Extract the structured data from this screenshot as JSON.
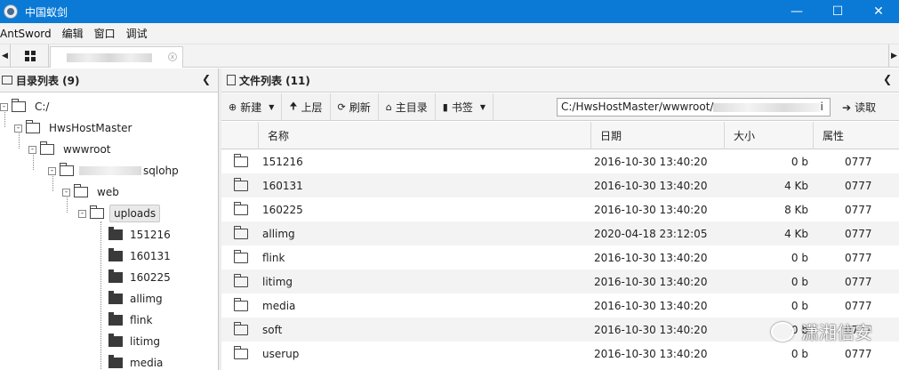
{
  "window": {
    "title": "中国蚁剑"
  },
  "menubar": {
    "items": [
      "AntSword",
      "编辑",
      "窗口",
      "调试"
    ]
  },
  "left_panel": {
    "header": "目录列表 (9)",
    "tree": {
      "root": "C:/",
      "hws": "HwsHostMaster",
      "wwwroot": "wwwroot",
      "site_suffix": "sqlohp",
      "web": "web",
      "uploads": "uploads",
      "children": [
        "151216",
        "160131",
        "160225",
        "allimg",
        "flink",
        "litimg",
        "media"
      ]
    }
  },
  "right_panel": {
    "header": "文件列表 (11)",
    "toolbar": {
      "new": "新建",
      "up": "上层",
      "refresh": "刷新",
      "home": "主目录",
      "bookmark": "书签",
      "path_prefix": "C:/HwsHostMaster/wwwroot/",
      "path_trail": "i",
      "read": "读取"
    },
    "columns": [
      "名称",
      "日期",
      "大小",
      "属性"
    ],
    "rows": [
      {
        "name": "151216",
        "date": "2016-10-30 13:40:20",
        "size": "0 b",
        "attr": "0777"
      },
      {
        "name": "160131",
        "date": "2016-10-30 13:40:20",
        "size": "4 Kb",
        "attr": "0777"
      },
      {
        "name": "160225",
        "date": "2016-10-30 13:40:20",
        "size": "8 Kb",
        "attr": "0777"
      },
      {
        "name": "allimg",
        "date": "2020-04-18 23:12:05",
        "size": "4 Kb",
        "attr": "0777"
      },
      {
        "name": "flink",
        "date": "2016-10-30 13:40:20",
        "size": "0 b",
        "attr": "0777"
      },
      {
        "name": "litimg",
        "date": "2016-10-30 13:40:20",
        "size": "0 b",
        "attr": "0777"
      },
      {
        "name": "media",
        "date": "2016-10-30 13:40:20",
        "size": "0 b",
        "attr": "0777"
      },
      {
        "name": "soft",
        "date": "2016-10-30 13:40:20",
        "size": "0 b",
        "attr": "0777"
      },
      {
        "name": "userup",
        "date": "2016-10-30 13:40:20",
        "size": "0 b",
        "attr": "0777"
      }
    ]
  },
  "watermark": {
    "text": "潇湘信安"
  }
}
